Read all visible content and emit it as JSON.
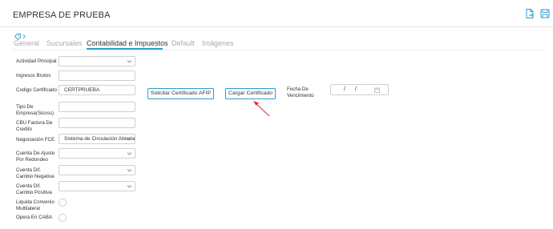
{
  "header": {
    "title": "EMPRESA DE PRUEBA",
    "icons": [
      "export-file-icon",
      "save-icon"
    ],
    "accent_color": "#2f9ccf"
  },
  "tag_icon": "tag-icon",
  "tabs": [
    {
      "label": "General",
      "active": false
    },
    {
      "label": "Sucursales",
      "active": false
    },
    {
      "label": "Contabilidad e Impuestos",
      "active": true
    },
    {
      "label": "Default",
      "active": false
    },
    {
      "label": "Imágenes",
      "active": false
    }
  ],
  "form": {
    "actividad_principal": {
      "label": "Actividad Principal",
      "value": ""
    },
    "ingresos_brutos": {
      "label": "Ingresos Brutos",
      "value": ""
    },
    "codigo_certificado": {
      "label": "Codigo Certificado",
      "value": "CERTPRUEBA"
    },
    "tipo_empresa": {
      "label_lines": [
        "Tipo De",
        "Empresa(Sicoss)"
      ],
      "value": ""
    },
    "cbu_factura": {
      "label_lines": [
        "CBU Factura De",
        "Credito"
      ],
      "value": ""
    },
    "negociacion_fce": {
      "label": "Negociación FCE",
      "value": "Sistema de Circulación Abierta"
    },
    "cuenta_ajuste": {
      "label_lines": [
        "Cuenta De Ajuste",
        "Por Redondeo"
      ],
      "value": ""
    },
    "cuenta_dif_negativa": {
      "label_lines": [
        "Cuenta Dif.",
        "Cambio Negativa"
      ],
      "value": ""
    },
    "cuenta_dif_positiva": {
      "label_lines": [
        "Cuenta Dif.",
        "Cambio Positiva"
      ],
      "value": ""
    },
    "liquida_convenio": {
      "label_lines": [
        "Liquida Convenio",
        "Multilateral"
      ],
      "checked": false
    },
    "opera_caba": {
      "label": "Opera En CABA",
      "checked": false
    }
  },
  "buttons": {
    "solicitar": "Solicitar Certificado AFIP",
    "cargar": "Cargar Certificado"
  },
  "fecha_vencimiento": {
    "label_lines": [
      "Fecha De",
      "Vencimiento"
    ],
    "separator": "/",
    "icon": "calendar-icon"
  },
  "annotation": {
    "icon": "red-arrow-icon",
    "color": "#e03030"
  }
}
